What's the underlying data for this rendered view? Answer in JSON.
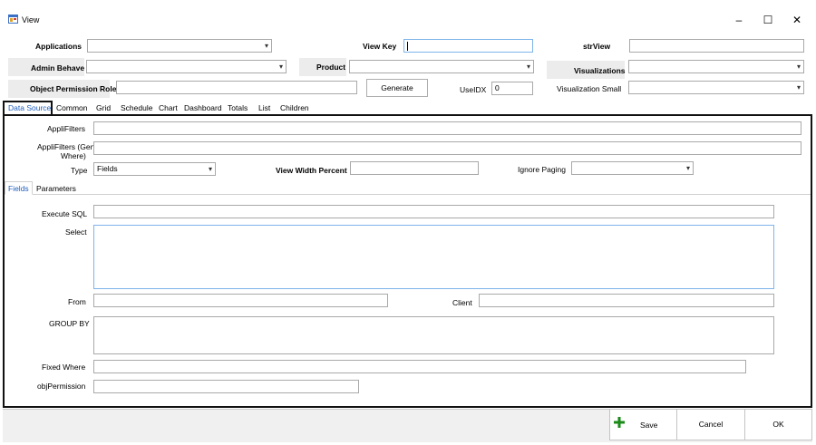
{
  "window": {
    "title": "View",
    "controls": {
      "minimize": "–",
      "maximize": "☐",
      "close": "✕"
    }
  },
  "top": {
    "applications_label": "Applications",
    "view_key_label": "View Key",
    "strview_label": "strView",
    "admin_behave_label": "Admin Behave",
    "product_label": "Product",
    "visualizations_label": "Visualizations",
    "object_permission_role_label": "Object Permission Role",
    "generate_label": "Generate",
    "useidx_label": "UseIDX",
    "useidx_value": "0",
    "visualization_small_label": "Visualization Small"
  },
  "tabs": [
    "Data Source",
    "Common",
    "Grid",
    "Schedule",
    "Chart",
    "Dashboard",
    "Totals",
    "List",
    "Children"
  ],
  "datasource": {
    "applifilters_label": "AppliFilters",
    "applifilters_gen_label_1": "AppliFilters (Generate",
    "applifilters_gen_label_2": "Where)",
    "type_label": "Type",
    "type_value": "Fields",
    "view_width_percent_label": "View Width Percent",
    "ignore_paging_label": "Ignore Paging"
  },
  "subtabs": [
    "Fields",
    "Parameters"
  ],
  "fields": {
    "execute_sql_label": "Execute SQL",
    "select_label": "Select",
    "from_label": "From",
    "client_label": "Client",
    "group_by_label": "GROUP BY",
    "fixed_where_label": "Fixed Where",
    "objpermission_label": "objPermission"
  },
  "footer": {
    "save_label": "Save",
    "cancel_label": "Cancel",
    "ok_label": "OK",
    "accent_color": "#1a8a1a"
  }
}
